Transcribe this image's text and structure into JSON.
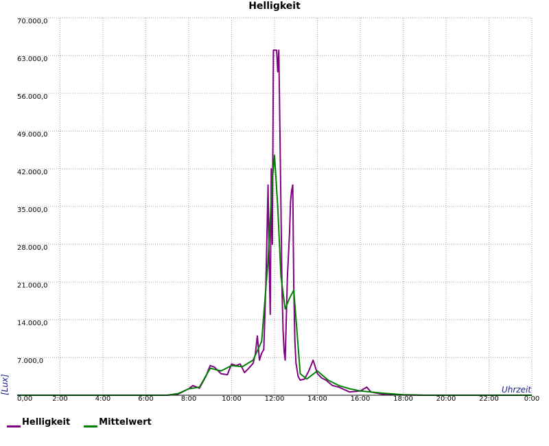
{
  "chart_data": {
    "type": "line",
    "title": "Helligkeit",
    "xlabel": "Uhrzeit",
    "ylabel": "[Lux]",
    "xlim": [
      0,
      24
    ],
    "ylim": [
      0,
      70000
    ],
    "grid": true,
    "legend_position": "bottom-left",
    "x_ticks": [
      "0,00",
      "2:00",
      "4:00",
      "6:00",
      "8:00",
      "10:00",
      "12:00",
      "14:00",
      "16:00",
      "18:00",
      "20:00",
      "22:00",
      "0:00"
    ],
    "y_ticks": [
      "7.000,0",
      "14.000,0",
      "21.000,0",
      "28.000,0",
      "35.000,0",
      "42.000,0",
      "49.000,0",
      "56.000,0",
      "63.000,0",
      "70.000,0"
    ],
    "series": [
      {
        "name": "Helligkeit",
        "color": "#800080",
        "x": [
          0,
          7.0,
          7.5,
          8.0,
          8.2,
          8.5,
          8.8,
          9.0,
          9.2,
          9.5,
          9.8,
          10.0,
          10.2,
          10.4,
          10.6,
          10.8,
          11.0,
          11.1,
          11.2,
          11.3,
          11.4,
          11.5,
          11.6,
          11.7,
          11.75,
          11.8,
          11.85,
          11.9,
          11.95,
          12.0,
          12.05,
          12.1,
          12.15,
          12.2,
          12.25,
          12.3,
          12.35,
          12.4,
          12.45,
          12.5,
          12.6,
          12.7,
          12.75,
          12.8,
          12.85,
          12.9,
          12.95,
          13.0,
          13.1,
          13.2,
          13.4,
          13.6,
          13.8,
          14.0,
          14.2,
          14.4,
          14.7,
          15.0,
          15.5,
          16.0,
          16.3,
          16.5,
          17.0,
          17.5,
          18.0,
          19.0,
          20.0,
          22.0,
          24.0
        ],
        "values": [
          0,
          0,
          200,
          1200,
          1800,
          1300,
          3500,
          5500,
          5200,
          4000,
          3800,
          5800,
          5500,
          5800,
          4200,
          5000,
          5900,
          7500,
          11000,
          6500,
          7800,
          8500,
          21000,
          39000,
          25000,
          15000,
          42000,
          28000,
          64000,
          64000,
          64000,
          64000,
          60000,
          64000,
          50000,
          35000,
          20000,
          12000,
          8000,
          6500,
          22000,
          30000,
          36000,
          38000,
          39000,
          20000,
          10000,
          6000,
          3500,
          2800,
          3000,
          4500,
          6500,
          4000,
          3200,
          2800,
          1800,
          1500,
          600,
          800,
          1500,
          600,
          200,
          100,
          50,
          0,
          0,
          0,
          0
        ]
      },
      {
        "name": "Mittelwert",
        "color": "#008000",
        "x": [
          0,
          7.0,
          7.5,
          8.0,
          8.5,
          9.0,
          9.5,
          10.0,
          10.5,
          11.0,
          11.4,
          11.7,
          11.9,
          12.0,
          12.15,
          12.3,
          12.5,
          12.7,
          12.9,
          13.2,
          13.5,
          14.0,
          14.5,
          15.0,
          15.5,
          16.0,
          16.5,
          17.0,
          18.0,
          19.0,
          24.0
        ],
        "values": [
          0,
          0,
          300,
          1200,
          1500,
          5000,
          4500,
          5500,
          5300,
          6500,
          10000,
          25000,
          40000,
          44500,
          35000,
          22000,
          16000,
          18000,
          19500,
          4000,
          3000,
          4500,
          2800,
          1800,
          1200,
          800,
          600,
          400,
          100,
          0,
          0
        ]
      }
    ]
  }
}
